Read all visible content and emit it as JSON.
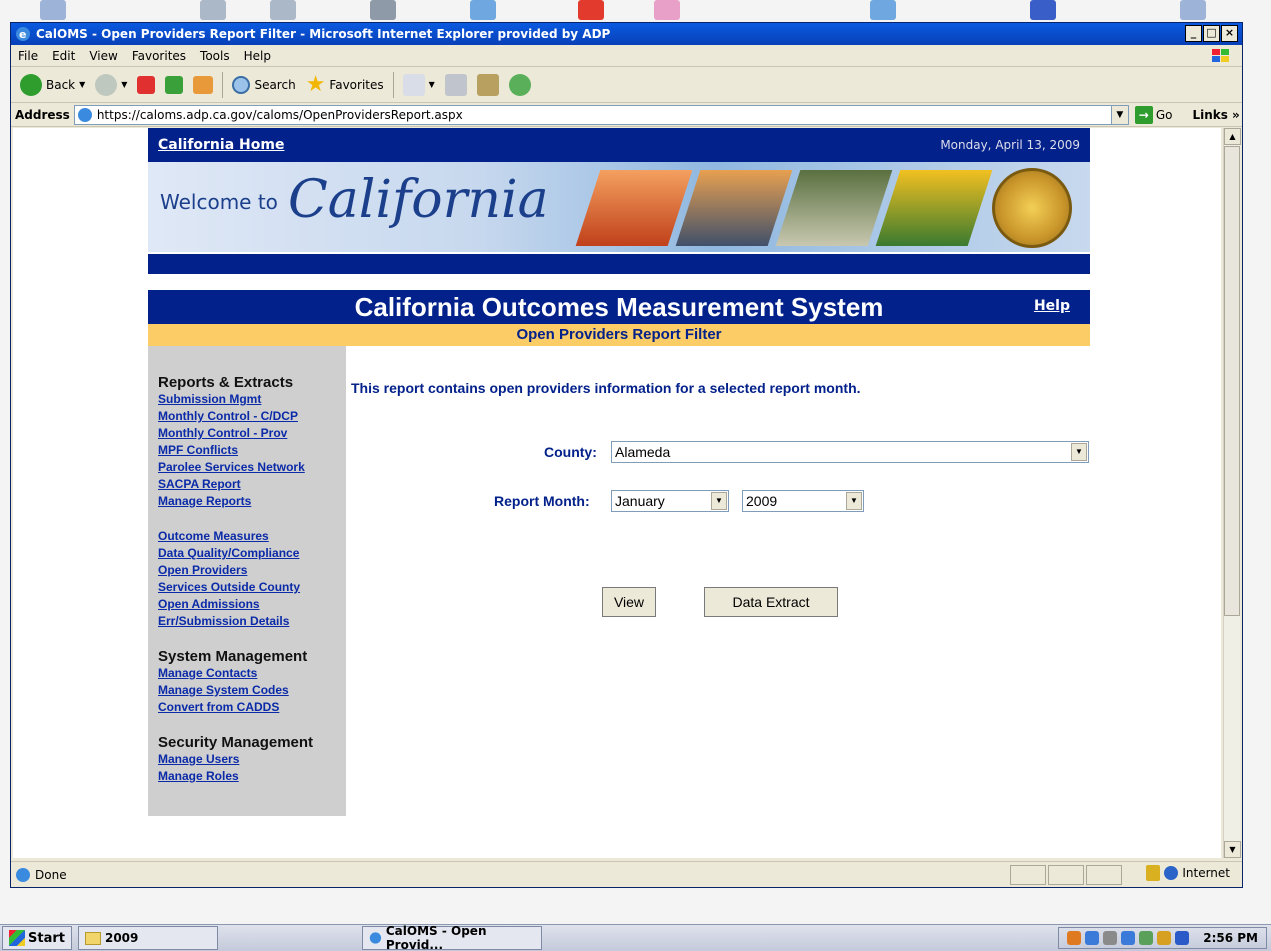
{
  "window": {
    "title": "CalOMS - Open Providers Report Filter - Microsoft Internet Explorer provided by ADP"
  },
  "menubar": [
    "File",
    "Edit",
    "View",
    "Favorites",
    "Tools",
    "Help"
  ],
  "toolbar": {
    "back_label": "Back",
    "search_label": "Search",
    "favorites_label": "Favorites"
  },
  "address": {
    "label": "Address",
    "url": "https://caloms.adp.ca.gov/caloms/OpenProvidersReport.aspx",
    "go_label": "Go",
    "links_label": "Links »"
  },
  "page": {
    "home_link": "California Home",
    "date": "Monday, April 13, 2009",
    "welcome_text": "Welcome to",
    "california_text": "California",
    "system_title": "California Outcomes Measurement System",
    "help_label": "Help",
    "filter_title": "Open Providers Report Filter",
    "intro": "This report contains open providers information for a selected report month."
  },
  "sidebar": {
    "reports_heading": "Reports & Extracts",
    "reports_links": [
      "Submission Mgmt",
      "Monthly Control - C/DCP",
      "Monthly Control - Prov",
      "MPF Conflicts",
      "Parolee Services Network",
      "SACPA Report",
      "Manage Reports"
    ],
    "outcomes_links": [
      "Outcome Measures",
      "Data Quality/Compliance",
      "Open Providers",
      "Services Outside County",
      "Open Admissions",
      "Err/Submission Details"
    ],
    "system_heading": "System Management",
    "system_links": [
      "Manage Contacts",
      "Manage System Codes",
      "Convert from CADDS"
    ],
    "security_heading": "Security Management",
    "security_links": [
      "Manage Users",
      "Manage Roles"
    ]
  },
  "form": {
    "county_label": "County:",
    "county_value": "Alameda",
    "month_label": "Report Month:",
    "month_value": "January",
    "year_value": "2009",
    "view_label": "View",
    "extract_label": "Data Extract"
  },
  "status": {
    "text": "Done",
    "zone": "Internet"
  },
  "taskbar": {
    "start": "Start",
    "folder": "2009",
    "window": "CalOMS - Open Provid...",
    "clock": "2:56 PM"
  },
  "colors": {
    "navy": "#03218a",
    "gold": "#fccc67",
    "link": "#0a2aa8"
  }
}
